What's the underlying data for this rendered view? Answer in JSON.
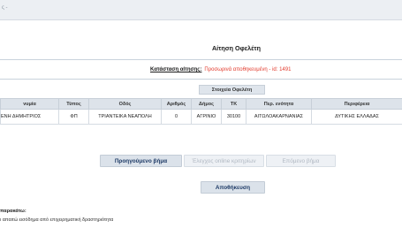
{
  "breadcrumb": "ς -",
  "title": "Αίτηση Οφελέτη",
  "status": {
    "label": "Κατάσταση αίτησης:",
    "value": "Προσωρινά αποθηκευμένη - id: 1491"
  },
  "section_title": "Στοιχεία Οφελέτη",
  "table": {
    "headers": [
      "νυμία",
      "Τύπος",
      "Οδός",
      "Αριθμός",
      "Δήμος",
      "ΤΚ",
      "Περ. ενότητα",
      "Περιφέρεια"
    ],
    "rows": [
      [
        "ΕΝΗ ΔΗΜΗΤΡΙΟΣ",
        "ΦΠ",
        "ΤΡΙΑΝΤΕΙΚΑ ΝΕΑΠΟΛΗ",
        "0",
        "ΑΓΡΙΝΙΟ",
        "30100",
        "ΑΙΤΩΛΟΑΚΑΡΝΑΝΙΑΣ",
        "ΔΥΤΙΚΗΣ ΕΛΛΑΔΑΣ"
      ]
    ]
  },
  "buttons": {
    "previous": "Προηγούμενο βήμα",
    "check": "Έλεγχος online κριτηρίων",
    "next": "Επόμενο βήμα",
    "save": "Αποθήκευση"
  },
  "notes": {
    "title": "παρακάτω:",
    "text": "ι απαιτώ εισόδημα από επιχειρηματική δραστηριότητα"
  }
}
